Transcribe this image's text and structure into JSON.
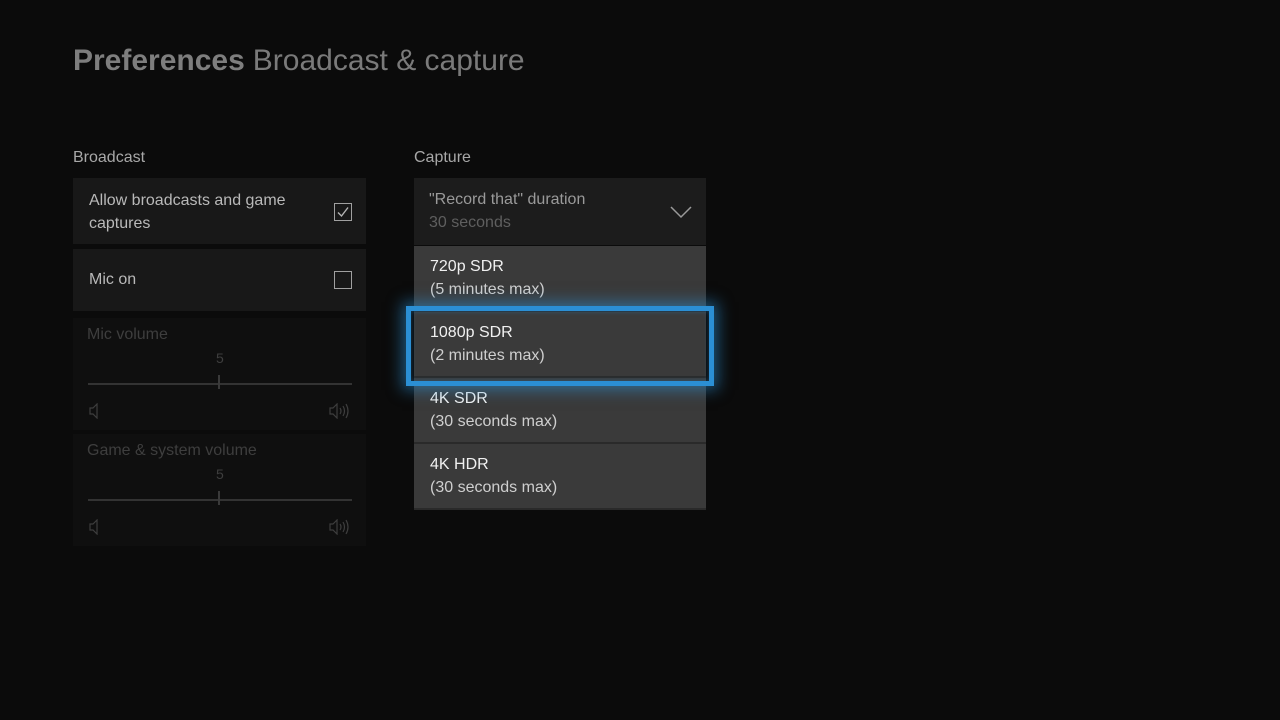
{
  "header": {
    "section": "Preferences",
    "page": "Broadcast & capture"
  },
  "broadcast": {
    "label": "Broadcast",
    "allow": {
      "label": "Allow broadcasts and game captures",
      "checked": true
    },
    "mic": {
      "label": "Mic on",
      "checked": false
    },
    "mic_volume": {
      "label": "Mic volume",
      "value": "5",
      "level": 0.5
    },
    "game_volume": {
      "label": "Game & system volume",
      "value": "5",
      "level": 0.5
    }
  },
  "capture": {
    "label": "Capture",
    "dropdown": {
      "title": "\"Record that\" duration",
      "value": "30 seconds"
    },
    "options": [
      {
        "l1": "720p SDR",
        "l2": "(5 minutes max)"
      },
      {
        "l1": "1080p SDR",
        "l2": "(2 minutes max)",
        "focused": true
      },
      {
        "l1": "4K SDR",
        "l2": "(30 seconds max)"
      },
      {
        "l1": "4K HDR",
        "l2": "(30 seconds max)"
      }
    ]
  },
  "icons": {
    "check": "checkmark-icon",
    "chevron": "chevron-down-icon",
    "vol_min": "volume-low-icon",
    "vol_max": "volume-high-icon"
  },
  "colors": {
    "focus": "#2b8fd4",
    "background": "#0b0b0b"
  }
}
